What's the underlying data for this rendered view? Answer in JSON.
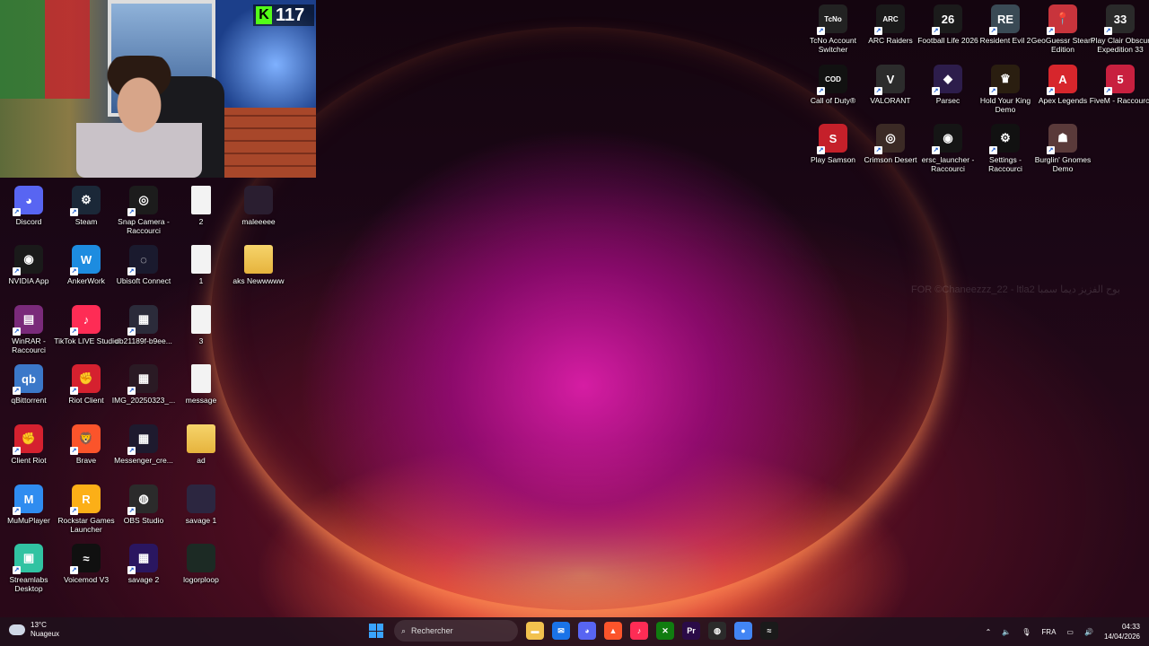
{
  "webcam": {
    "badge_letter": "K",
    "badge_count": "117"
  },
  "desktop_left": [
    {
      "label": "Discord",
      "icon": "discord-icon",
      "color": "#5865f2",
      "glyph": "◕"
    },
    {
      "label": "NVIDIA App",
      "icon": "nvidia-icon",
      "color": "#1a1a1a",
      "glyph": "◉"
    },
    {
      "label": "WinRAR - Raccourci",
      "icon": "winrar-icon",
      "color": "#7a2a7a",
      "glyph": "▤"
    },
    {
      "label": "qBittorrent",
      "icon": "qbittorrent-icon",
      "color": "#3b78c9",
      "glyph": "qb"
    },
    {
      "label": "Client Riot",
      "icon": "riot-icon",
      "color": "#d5212f",
      "glyph": "✊"
    },
    {
      "label": "MuMuPlayer",
      "icon": "mumuplayer-icon",
      "color": "#2f8cf0",
      "glyph": "M"
    },
    {
      "label": "Streamlabs Desktop",
      "icon": "streamlabs-icon",
      "color": "#31c3a2",
      "glyph": "▣"
    }
  ],
  "desktop_col2": [
    {
      "label": "Steam",
      "icon": "steam-icon",
      "color": "#1b2838",
      "glyph": "⚙"
    },
    {
      "label": "AnkerWork",
      "icon": "ankerwork-icon",
      "color": "#1d8ce0",
      "glyph": "W"
    },
    {
      "label": "TikTok LIVE Studio",
      "icon": "tiktok-icon",
      "color": "#fe2c55",
      "glyph": "♪"
    },
    {
      "label": "Riot Client",
      "icon": "riot-client-icon",
      "color": "#d5212f",
      "glyph": "✊"
    },
    {
      "label": "Brave",
      "icon": "brave-icon",
      "color": "#fb542b",
      "glyph": "🦁"
    },
    {
      "label": "Rockstar Games Launcher",
      "icon": "rockstar-icon",
      "color": "#fcaf17",
      "glyph": "R"
    },
    {
      "label": "Voicemod V3",
      "icon": "voicemod-icon",
      "color": "#101010",
      "glyph": "≈"
    }
  ],
  "desktop_col3": [
    {
      "label": "Snap Camera - Raccourci",
      "icon": "snap-camera-icon",
      "color": "#1c1c1c",
      "glyph": "◎"
    },
    {
      "label": "Ubisoft Connect",
      "icon": "ubisoft-icon",
      "color": "#1a1a2e",
      "glyph": "◌"
    },
    {
      "label": "db21189f-b9ee...",
      "icon": "image-file-icon",
      "color": "#2b2b3a",
      "glyph": "▦"
    },
    {
      "label": "IMG_20250323_...",
      "icon": "image-file-icon",
      "color": "#2a1a24",
      "glyph": "▦"
    },
    {
      "label": "Messenger_cre...",
      "icon": "image-file-icon",
      "color": "#1e1a2e",
      "glyph": "▦"
    },
    {
      "label": "OBS Studio",
      "icon": "obs-icon",
      "color": "#2b2b2b",
      "glyph": "◍"
    },
    {
      "label": "savage 2",
      "icon": "image-file-icon",
      "color": "#2a1660",
      "glyph": "▦"
    }
  ],
  "desktop_col4": [
    {
      "label": "2",
      "icon": "text-file-icon",
      "type": "doc"
    },
    {
      "label": "1",
      "icon": "text-file-icon",
      "type": "doc"
    },
    {
      "label": "3",
      "icon": "text-file-icon",
      "type": "doc"
    },
    {
      "label": "message",
      "icon": "text-file-icon",
      "type": "doc"
    },
    {
      "label": "ad",
      "icon": "folder-icon",
      "type": "folder"
    },
    {
      "label": "savage 1",
      "icon": "image-file-icon",
      "type": "img",
      "color": "#2c2640"
    },
    {
      "label": "logorploop",
      "icon": "image-file-icon",
      "type": "img",
      "color": "#1c2a24"
    }
  ],
  "desktop_col5": [
    {
      "label": "maleeeee",
      "icon": "image-file-icon",
      "type": "img",
      "color": "#2a1e30"
    },
    {
      "label": "aks Newwwww",
      "icon": "folder-icon",
      "type": "folder"
    }
  ],
  "desktop_top": [
    {
      "label": "TcNo Account Switcher",
      "icon": "tcno-icon",
      "color": "#222",
      "glyph": "TcNo"
    },
    {
      "label": "ARC Raiders",
      "icon": "arc-raiders-icon",
      "color": "#1a1a1a",
      "glyph": "ARC"
    },
    {
      "label": "Football Life 2026",
      "icon": "football-life-icon",
      "color": "#1b1b1b",
      "glyph": "26"
    },
    {
      "label": "Resident Evil 2",
      "icon": "resident-evil-icon",
      "color": "#3a4a55",
      "glyph": "RE"
    },
    {
      "label": "GeoGuessr Steam Edition",
      "icon": "geoguessr-icon",
      "color": "#c8343c",
      "glyph": "📍"
    },
    {
      "label": "Play Clair Obscur Expedition 33",
      "icon": "clair-obscur-icon",
      "color": "#2a2a2a",
      "glyph": "33"
    },
    {
      "label": "Call of Duty®",
      "icon": "call-of-duty-icon",
      "color": "#111",
      "glyph": "COD"
    },
    {
      "label": "VALORANT",
      "icon": "valorant-icon",
      "color": "#2c2c2c",
      "glyph": "V"
    },
    {
      "label": "Parsec",
      "icon": "parsec-icon",
      "color": "#2d1d4b",
      "glyph": "◆"
    },
    {
      "label": "Hold Your King Demo",
      "icon": "hold-your-king-icon",
      "color": "#2a1e10",
      "glyph": "♛"
    },
    {
      "label": "Apex Legends",
      "icon": "apex-icon",
      "color": "#d7262c",
      "glyph": "A"
    },
    {
      "label": "FiveM - Raccourci",
      "icon": "fivem-icon",
      "color": "#c8203f",
      "glyph": "5"
    },
    {
      "label": "Play Samson",
      "icon": "samson-icon",
      "color": "#c5202a",
      "glyph": "S"
    },
    {
      "label": "Crimson Desert",
      "icon": "crimson-desert-icon",
      "color": "#3b2a25",
      "glyph": "◎"
    },
    {
      "label": "ersc_launcher - Raccourci",
      "icon": "ersc-launcher-icon",
      "color": "#151515",
      "glyph": "◉"
    },
    {
      "label": "Settings - Raccourci",
      "icon": "settings-icon",
      "color": "#111",
      "glyph": "⚙"
    },
    {
      "label": "Burglin' Gnomes Demo",
      "icon": "burglin-gnomes-icon",
      "color": "#5a3a3a",
      "glyph": "☗"
    }
  ],
  "watermark": "FOR ©Chaneezzz_22 - ltla2 بوح الفزيز ديما سمبا",
  "taskbar": {
    "weather_temp": "13°C",
    "weather_desc": "Nuageux",
    "search_placeholder": "Rechercher",
    "apps": [
      {
        "name": "file-explorer-icon",
        "color": "#f2c14e",
        "glyph": "▬"
      },
      {
        "name": "outlook-icon",
        "color": "#1a73e8",
        "glyph": "✉"
      },
      {
        "name": "discord-taskbar-icon",
        "color": "#5865f2",
        "glyph": "◕"
      },
      {
        "name": "brave-taskbar-icon",
        "color": "#fb542b",
        "glyph": "▲"
      },
      {
        "name": "tiktok-taskbar-icon",
        "color": "#fe2c55",
        "glyph": "♪"
      },
      {
        "name": "xbox-icon",
        "color": "#107c10",
        "glyph": "✕"
      },
      {
        "name": "premiere-icon",
        "color": "#2a0b47",
        "glyph": "Pr"
      },
      {
        "name": "obs-taskbar-icon",
        "color": "#2b2b2b",
        "glyph": "◍"
      },
      {
        "name": "chrome-icon",
        "color": "#4285f4",
        "glyph": "●"
      },
      {
        "name": "voicemod-taskbar-icon",
        "color": "#1a1a1a",
        "glyph": "≈"
      }
    ],
    "lang": "FRA",
    "time": "04:33",
    "date": "14/04/2026"
  }
}
